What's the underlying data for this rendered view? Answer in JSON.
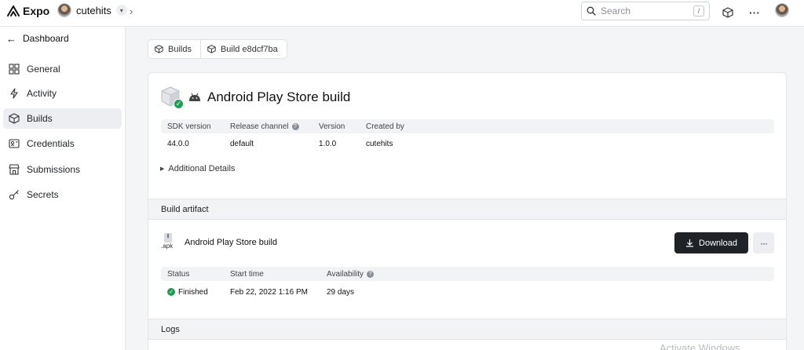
{
  "topbar": {
    "logo": "Expo",
    "account_name": "cutehits",
    "search_placeholder": "Search",
    "search_shortcut": "/",
    "more": "···"
  },
  "sidebar": {
    "back_label": "Dashboard",
    "items": [
      {
        "label": "General",
        "icon": "grid-icon"
      },
      {
        "label": "Activity",
        "icon": "lightning-icon"
      },
      {
        "label": "Builds",
        "icon": "cube-icon",
        "active": true
      },
      {
        "label": "Credentials",
        "icon": "id-card-icon"
      },
      {
        "label": "Submissions",
        "icon": "store-icon"
      },
      {
        "label": "Secrets",
        "icon": "key-icon"
      }
    ]
  },
  "breadcrumb": [
    "Builds",
    "Build e8dcf7ba"
  ],
  "build": {
    "title": "Android Play Store build",
    "status_color": "#1f9d55",
    "meta_headers": [
      "SDK version",
      "Release channel",
      "Version",
      "Created by"
    ],
    "meta_values": [
      "44.0.0",
      "default",
      "1.0.0",
      "cutehits"
    ],
    "additional_details": "Additional Details"
  },
  "artifact": {
    "section_label": "Build artifact",
    "file_ext": ".apk",
    "name": "Android Play Store build",
    "download_label": "Download",
    "more_label": "···",
    "headers": [
      "Status",
      "Start time",
      "Availability"
    ],
    "values": [
      "Finished",
      "Feb 22, 2022 1:16 PM",
      "29 days"
    ]
  },
  "logs": {
    "section_label": "Logs"
  },
  "watermark": "Activate Windows"
}
